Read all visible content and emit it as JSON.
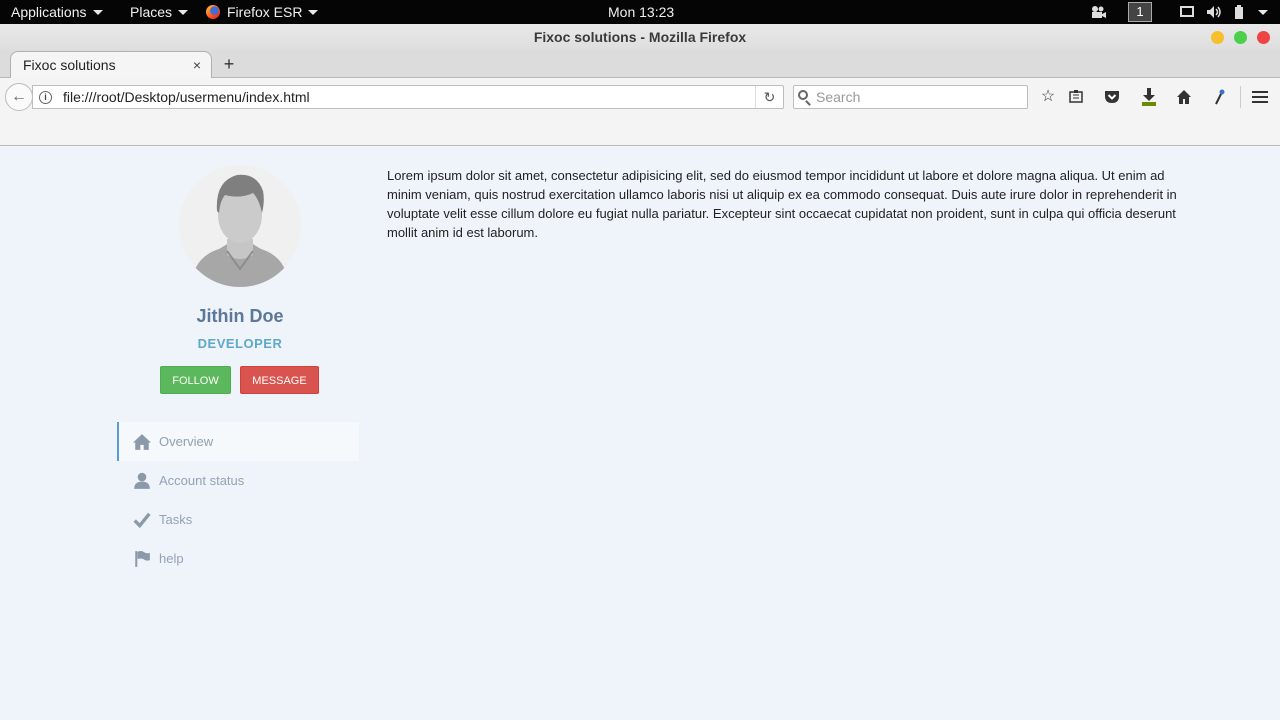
{
  "topbar": {
    "applications": "Applications",
    "places": "Places",
    "firefox_app": "Firefox ESR",
    "clock": "Mon 13:23",
    "workspace": "1"
  },
  "window": {
    "title": "Fixoc solutions - Mozilla Firefox"
  },
  "tabs": [
    {
      "label": "Fixoc solutions",
      "close": "×"
    }
  ],
  "newtab_label": "+",
  "nav": {
    "url": "file:///root/Desktop/usermenu/index.html",
    "search_placeholder": "Search"
  },
  "profile": {
    "name": "Jithin Doe",
    "role": "DEVELOPER",
    "follow_label": "FOLLOW",
    "message_label": "MESSAGE"
  },
  "menu": {
    "items": [
      {
        "label": "Overview",
        "icon": "home-icon",
        "active": true
      },
      {
        "label": "Account status",
        "icon": "user-icon",
        "active": false
      },
      {
        "label": "Tasks",
        "icon": "check-icon",
        "active": false
      },
      {
        "label": "help",
        "icon": "flag-icon",
        "active": false
      }
    ]
  },
  "content": {
    "paragraph": "Lorem ipsum dolor sit amet, consectetur adipisicing elit, sed do eiusmod tempor incididunt ut labore et dolore magna aliqua. Ut enim ad minim veniam, quis nostrud exercitation ullamco laboris nisi ut aliquip ex ea commodo consequat. Duis aute irure dolor in reprehenderit in voluptate velit esse cillum dolore eu fugiat nulla pariatur. Excepteur sint occaecat cupidatat non proident, sunt in culpa qui officia deserunt mollit anim id est laborum."
  },
  "colors": {
    "page_bg": "#eff3fa",
    "follow": "#5cb85c",
    "message": "#d9534f",
    "name": "#5b7899",
    "role": "#5fa8c9"
  }
}
